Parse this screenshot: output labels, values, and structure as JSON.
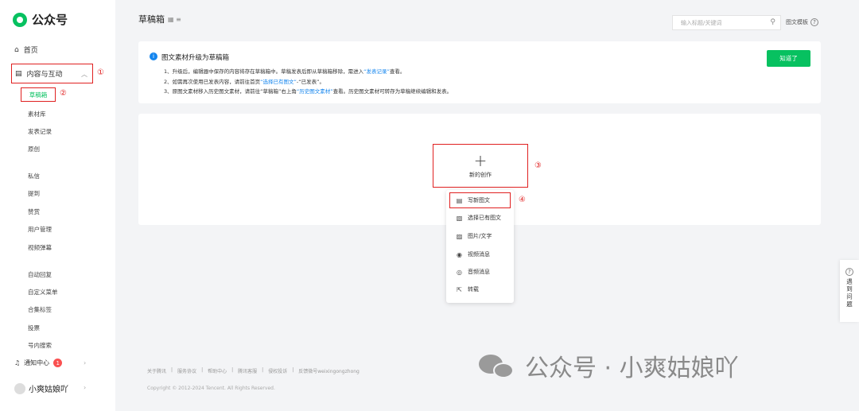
{
  "sidebar": {
    "brand": "公众号",
    "home": "首页",
    "group": "内容与互动",
    "active_item": "草稿箱",
    "items_a": [
      "素材库",
      "发表记录",
      "原创"
    ],
    "items_b": [
      "私信",
      "提到",
      "赞赏",
      "用户管理",
      "视频弹幕"
    ],
    "items_c": [
      "自动回复",
      "自定义菜单",
      "合集标签",
      "投票",
      "号内搜索"
    ],
    "notify": "通知中心",
    "notify_count": "1",
    "account": "小爽姑娘吖",
    "markers": [
      "①",
      "②"
    ]
  },
  "header": {
    "title": "草稿箱",
    "search_placeholder": "输入标题/关键词",
    "template": "图文模板"
  },
  "notice": {
    "title": "图文素材升级为草稿箱",
    "line1_a": "1、升级后，编辑器中保存的内容将存在草稿箱中。草稿发表后即从草稿箱移除，需进入",
    "line1_link": "“发表记录”",
    "line1_b": "查看。",
    "line2_a": "2、如需再次使用已发表内容，请前往首页",
    "line2_link": "“选择已有图文”",
    "line2_b": "-“已发表”。",
    "line3_a": "3、原图文素材移入历史图文素材，请前往“草稿箱”右上角",
    "line3_link": "“历史图文素材”",
    "line3_b": "查看。历史图文素材可转存为草稿继续编辑和发表。",
    "ok": "知道了"
  },
  "create": {
    "label": "新的创作",
    "marker3": "③",
    "marker4": "④"
  },
  "menu": {
    "items": [
      "写新图文",
      "选择已有图文",
      "图片/文字",
      "视频消息",
      "音频消息",
      "转载"
    ]
  },
  "footer": {
    "links": [
      "关于腾讯",
      "服务协议",
      "帮助中心",
      "腾讯客服",
      "侵权投诉",
      "反馈微号weixingongzhong"
    ],
    "copyright": "Copyright © 2012-2024 Tencent. All Rights Reserved."
  },
  "watermark": "公众号 · 小爽姑娘吖",
  "feedback": "遇到问题",
  "colors": {
    "brand": "#07c160",
    "annotation": "#e02020",
    "link": "#1485ee"
  }
}
